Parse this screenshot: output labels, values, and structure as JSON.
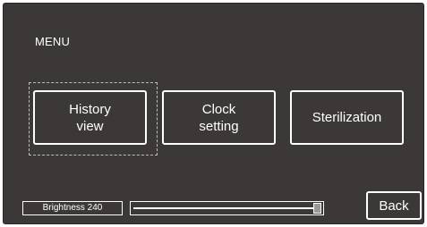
{
  "screen": {
    "title": "MENU"
  },
  "menu": {
    "items": [
      {
        "label": "History\nview",
        "focused": true
      },
      {
        "label": "Clock\nsetting",
        "focused": false
      },
      {
        "label": "Sterilization",
        "focused": false
      }
    ]
  },
  "brightness": {
    "label": "Brightness 240",
    "level_fraction": 1.0
  },
  "footer": {
    "back_label": "Back"
  },
  "colors": {
    "background": "#3c3838",
    "foreground": "#ffffff",
    "thumb": "#9b9898"
  }
}
